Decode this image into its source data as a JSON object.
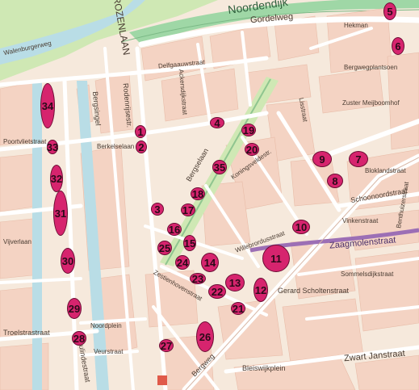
{
  "map": {
    "marker_color": "#d6246e",
    "road_color": "#ffffff",
    "block_color": "#f4d3c3",
    "background_color": "#f6e9dc",
    "water_color": "#b9dde6",
    "park_color": "#cfe8b4",
    "highway_color": "#9fd7a6",
    "purple_road_color": "#9c6fb5"
  },
  "streets": [
    {
      "name": "Noordendijk"
    },
    {
      "name": "Gordelweg"
    },
    {
      "name": "ROZENLAAN"
    },
    {
      "name": "Delfgaauwstraat"
    },
    {
      "name": "Bergsingel"
    },
    {
      "name": "Rodenrijsestr."
    },
    {
      "name": "Ackersdijkstraat"
    },
    {
      "name": "Bergselaan"
    },
    {
      "name": "Koningsveldestr."
    },
    {
      "name": "Willebrordusstraat"
    },
    {
      "name": "Zaagmolenstraat"
    },
    {
      "name": "Schoonoordstraat"
    },
    {
      "name": "Bleiswijkplein"
    },
    {
      "name": "Zwart Janstraat"
    },
    {
      "name": "Insulindestraat"
    },
    {
      "name": "Troelstrastraat"
    },
    {
      "name": "Noordplein"
    },
    {
      "name": "Veurstraat"
    },
    {
      "name": "Poortvlietstraat"
    },
    {
      "name": "Berkelselaan"
    },
    {
      "name": "Bergweg"
    },
    {
      "name": "Zestienhovenstraat"
    },
    {
      "name": "Gerard Scholtenstraat"
    },
    {
      "name": "Sommelsdijkstraat"
    },
    {
      "name": "Vinkenstraat"
    },
    {
      "name": "Bloklandstraat"
    },
    {
      "name": "Benthuizerstraat"
    },
    {
      "name": "Lisstraat"
    },
    {
      "name": "Zuster Meijboomhof"
    },
    {
      "name": "Bergwegplantsoen"
    },
    {
      "name": "Hekman"
    },
    {
      "name": "Vijverlaan"
    },
    {
      "name": "Walenburgerweg"
    }
  ],
  "markers": [
    {
      "label": "1"
    },
    {
      "label": "2"
    },
    {
      "label": "3"
    },
    {
      "label": "4"
    },
    {
      "label": "5"
    },
    {
      "label": "6"
    },
    {
      "label": "7"
    },
    {
      "label": "8"
    },
    {
      "label": "9"
    },
    {
      "label": "10"
    },
    {
      "label": "11"
    },
    {
      "label": "12"
    },
    {
      "label": "13"
    },
    {
      "label": "14"
    },
    {
      "label": "15"
    },
    {
      "label": "16"
    },
    {
      "label": "17"
    },
    {
      "label": "18"
    },
    {
      "label": "19"
    },
    {
      "label": "20"
    },
    {
      "label": "21"
    },
    {
      "label": "22"
    },
    {
      "label": "23"
    },
    {
      "label": "24"
    },
    {
      "label": "25"
    },
    {
      "label": "26"
    },
    {
      "label": "27"
    },
    {
      "label": "28"
    },
    {
      "label": "29"
    },
    {
      "label": "30"
    },
    {
      "label": "31"
    },
    {
      "label": "32"
    },
    {
      "label": "33"
    },
    {
      "label": "34"
    },
    {
      "label": "35"
    }
  ]
}
